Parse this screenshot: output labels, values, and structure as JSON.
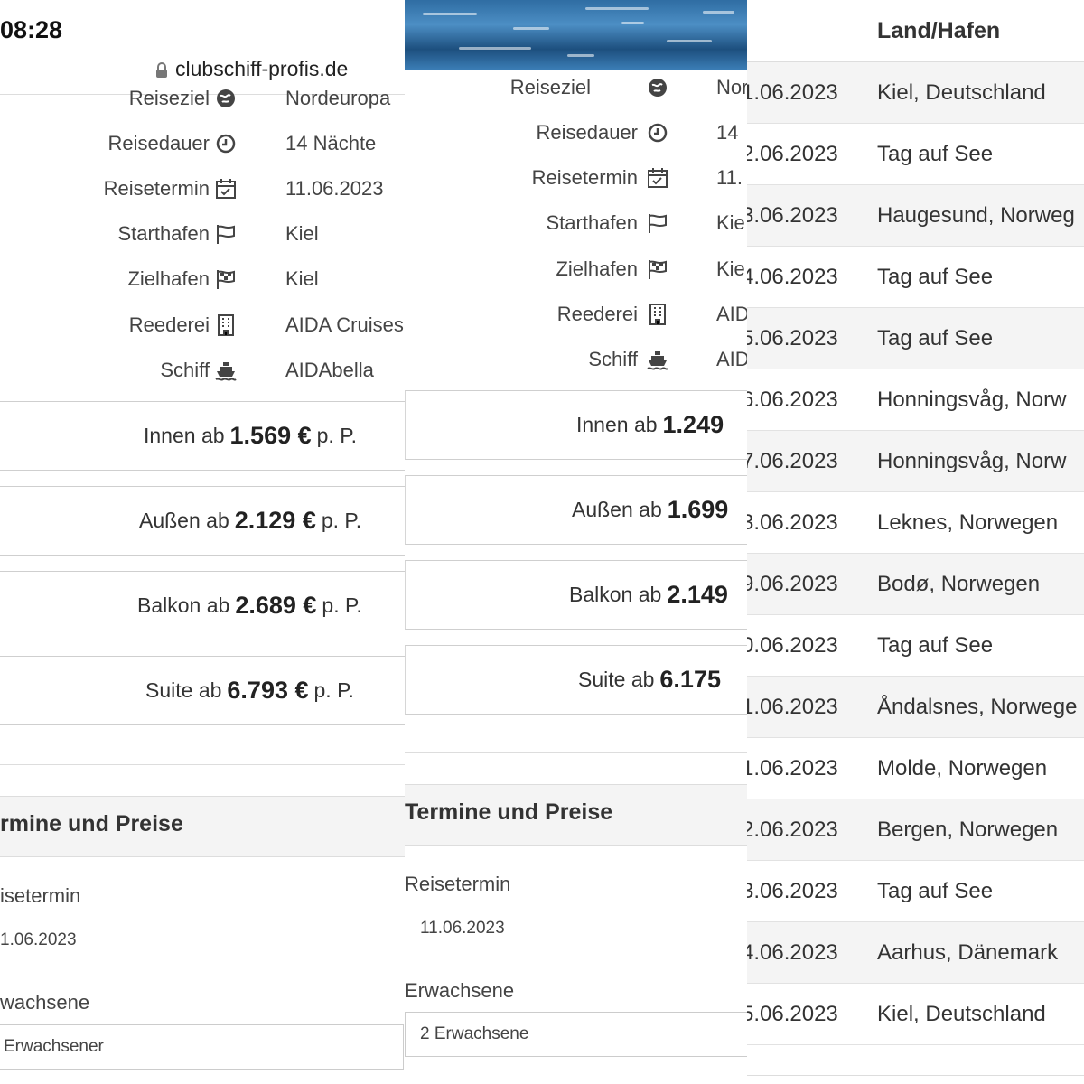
{
  "status_bar": {
    "time": "08:28"
  },
  "browser": {
    "url": "clubschiff-profis.de"
  },
  "panel1": {
    "specs": [
      {
        "label": "Reiseziel",
        "value": "Nordeuropa",
        "icon": "globe-icon"
      },
      {
        "label": "Reisedauer",
        "value": "14 Nächte",
        "icon": "clock-icon"
      },
      {
        "label": "Reisetermin",
        "value": "11.06.2023",
        "icon": "calendar-check-icon"
      },
      {
        "label": "Starthafen",
        "value": "Kiel",
        "icon": "flag-icon"
      },
      {
        "label": "Zielhafen",
        "value": "Kiel",
        "icon": "checkered-flag-icon"
      },
      {
        "label": "Reederei",
        "value": "AIDA Cruises",
        "icon": "building-icon"
      },
      {
        "label": "Schiff",
        "value": "AIDAbella",
        "icon": "ship-icon"
      }
    ],
    "prices": [
      {
        "category": "Innen ab",
        "amount": "1.569 €",
        "unit": "p. P."
      },
      {
        "category": "Außen ab",
        "amount": "2.129 €",
        "unit": "p. P."
      },
      {
        "category": "Balkon ab",
        "amount": "2.689 €",
        "unit": "p. P."
      },
      {
        "category": "Suite ab",
        "amount": "6.793 €",
        "unit": "p. P."
      }
    ],
    "section_title": "rmine und Preise",
    "date_label": "isetermin",
    "date_value": "1.06.2023",
    "adults_label": "wachsene",
    "adults_value": "Erwachsener"
  },
  "panel2": {
    "specs": [
      {
        "label": "Reiseziel",
        "value": "Nor",
        "icon": "globe-icon"
      },
      {
        "label": "Reisedauer",
        "value": "14",
        "icon": "clock-icon"
      },
      {
        "label": "Reisetermin",
        "value": "11.",
        "icon": "calendar-check-icon"
      },
      {
        "label": "Starthafen",
        "value": "Kie",
        "icon": "flag-icon"
      },
      {
        "label": "Zielhafen",
        "value": "Kie",
        "icon": "checkered-flag-icon"
      },
      {
        "label": "Reederei",
        "value": "AID",
        "icon": "building-icon"
      },
      {
        "label": "Schiff",
        "value": "AID",
        "icon": "ship-icon"
      }
    ],
    "prices": [
      {
        "category": "Innen ab",
        "amount": "1.249"
      },
      {
        "category": "Außen ab",
        "amount": "1.699"
      },
      {
        "category": "Balkon ab",
        "amount": "2.149"
      },
      {
        "category": "Suite ab",
        "amount": "6.175"
      }
    ],
    "section_title": "Termine und Preise",
    "date_label": "Reisetermin",
    "date_value": "11.06.2023",
    "adults_label": "Erwachsene",
    "adults_value": "2 Erwachsene"
  },
  "panel3": {
    "header": "Land/Hafen",
    "rows": [
      {
        "date": "1.06.2023",
        "port": "Kiel, Deutschland"
      },
      {
        "date": "2.06.2023",
        "port": "Tag auf See"
      },
      {
        "date": "3.06.2023",
        "port": "Haugesund, Norweg"
      },
      {
        "date": "4.06.2023",
        "port": "Tag auf See"
      },
      {
        "date": "5.06.2023",
        "port": "Tag auf See"
      },
      {
        "date": "6.06.2023",
        "port": "Honningsvåg, Norw"
      },
      {
        "date": "7.06.2023",
        "port": "Honningsvåg, Norw"
      },
      {
        "date": "3.06.2023",
        "port": "Leknes, Norwegen"
      },
      {
        "date": "9.06.2023",
        "port": "Bodø, Norwegen"
      },
      {
        "date": "0.06.2023",
        "port": "Tag auf See"
      },
      {
        "date": "1.06.2023",
        "port": "Åndalsnes, Norwege"
      },
      {
        "date": "1.06.2023",
        "port": "Molde, Norwegen"
      },
      {
        "date": "2.06.2023",
        "port": "Bergen, Norwegen"
      },
      {
        "date": "3.06.2023",
        "port": "Tag auf See"
      },
      {
        "date": "4.06.2023",
        "port": "Aarhus, Dänemark"
      },
      {
        "date": "5.06.2023",
        "port": "Kiel, Deutschland"
      }
    ]
  }
}
